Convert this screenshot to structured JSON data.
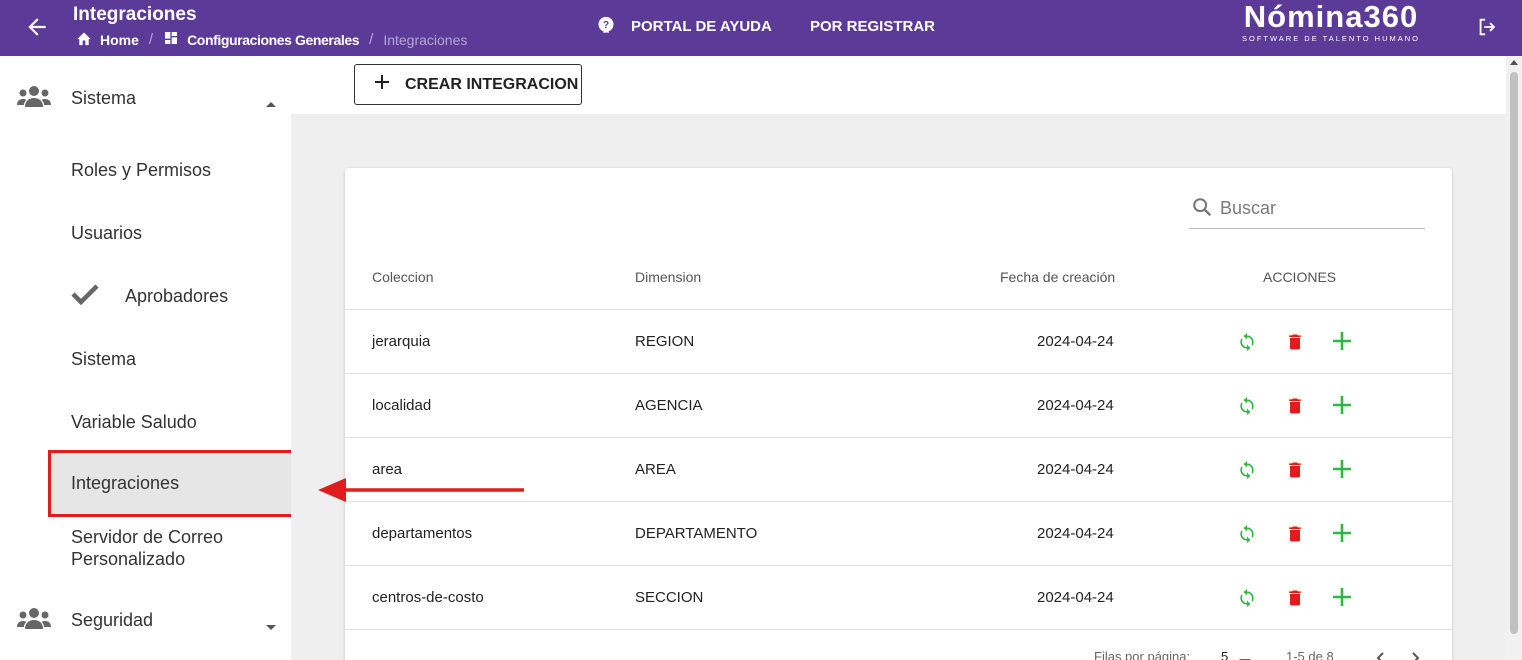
{
  "header": {
    "title": "Integraciones",
    "breadcrumb": {
      "home": "Home",
      "config": "Configuraciones Generales",
      "current": "Integraciones"
    },
    "help_label": "PORTAL DE AYUDA",
    "register_label": "POR REGISTRAR",
    "logo": {
      "name": "Nómina360",
      "tagline": "SOFTWARE DE TALENTO HUMANO"
    },
    "colors": {
      "bar": "#5c3a97"
    }
  },
  "sidebar": {
    "group_sistema": "Sistema",
    "items": [
      "Roles y Permisos",
      "Usuarios",
      "Aprobadores",
      "Sistema",
      "Variable Saludo",
      "Integraciones",
      "Servidor de Correo",
      "Personalizado"
    ],
    "group_seguridad": "Seguridad",
    "active": "Integraciones"
  },
  "toolbar": {
    "create_label": "CREAR INTEGRACION"
  },
  "table": {
    "search_placeholder": "Buscar",
    "columns": [
      "Coleccion",
      "Dimension",
      "Fecha de creación",
      "ACCIONES"
    ],
    "rows": [
      {
        "coleccion": "jerarquia",
        "dimension": "REGION",
        "fecha": "2024-04-24"
      },
      {
        "coleccion": "localidad",
        "dimension": "AGENCIA",
        "fecha": "2024-04-24"
      },
      {
        "coleccion": "area",
        "dimension": "AREA",
        "fecha": "2024-04-24"
      },
      {
        "coleccion": "departamentos",
        "dimension": "DEPARTAMENTO",
        "fecha": "2024-04-24"
      },
      {
        "coleccion": "centros-de-costo",
        "dimension": "SECCION",
        "fecha": "2024-04-24"
      }
    ],
    "action_icons": [
      "sync-icon",
      "trash-icon",
      "add-icon"
    ],
    "colors": {
      "sync": "#2eb83f",
      "trash": "#e11c1c",
      "add": "#2eb83f"
    }
  },
  "pagination": {
    "rows_label": "Filas por página:",
    "rows_value": "5",
    "range": "1-5 de 8"
  },
  "annotation": {
    "color": "#e11c1c"
  }
}
